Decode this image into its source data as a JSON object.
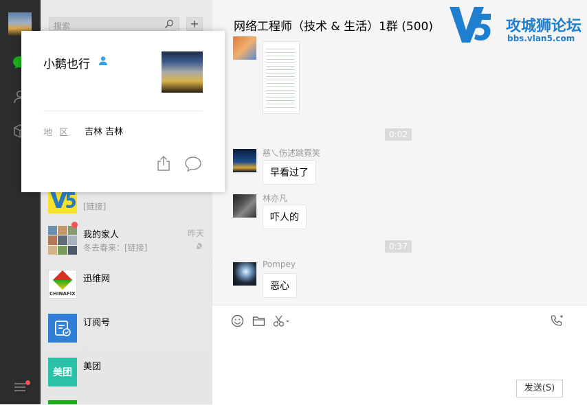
{
  "window": {
    "minimize": "—",
    "maximize": "☐",
    "close": "✕"
  },
  "search": {
    "placeholder": "搜索"
  },
  "plus_label": "+",
  "chat": {
    "title": "网络工程师（技术 & 生活）1群 (500)",
    "logo": {
      "mark": "V5",
      "brand": "攻城狮论坛",
      "url": "bbs.vlan5.com"
    },
    "timestamps": [
      "0:02",
      "0:37"
    ],
    "messages": [
      {
        "sender": "慈乀伤述跳霓笑",
        "text": "早看过了"
      },
      {
        "sender": "林亦凡",
        "text": "吓人的"
      },
      {
        "sender": "Pompey",
        "text": "恶心"
      }
    ],
    "send_label": "发送(S)"
  },
  "contacts": [
    {
      "name": "",
      "subtitle": "[链接]",
      "time": ""
    },
    {
      "name": "我的家人",
      "subtitle": "冬去春来：[链接]",
      "time": "昨天"
    },
    {
      "name": "迅维网",
      "subtitle": "",
      "time": "",
      "logo_text": "CHINAFIX"
    },
    {
      "name": "订阅号",
      "subtitle": "",
      "time": ""
    },
    {
      "name": "美团",
      "subtitle": "",
      "time": "",
      "logo_text": "美团"
    }
  ],
  "card": {
    "name": "小鹅也行",
    "region_label": "地区",
    "region_value": "吉林 吉林"
  },
  "colors": {
    "accent_green": "#1aad19",
    "badge_red": "#fa5151",
    "sidebar": "#2b2c2e"
  }
}
